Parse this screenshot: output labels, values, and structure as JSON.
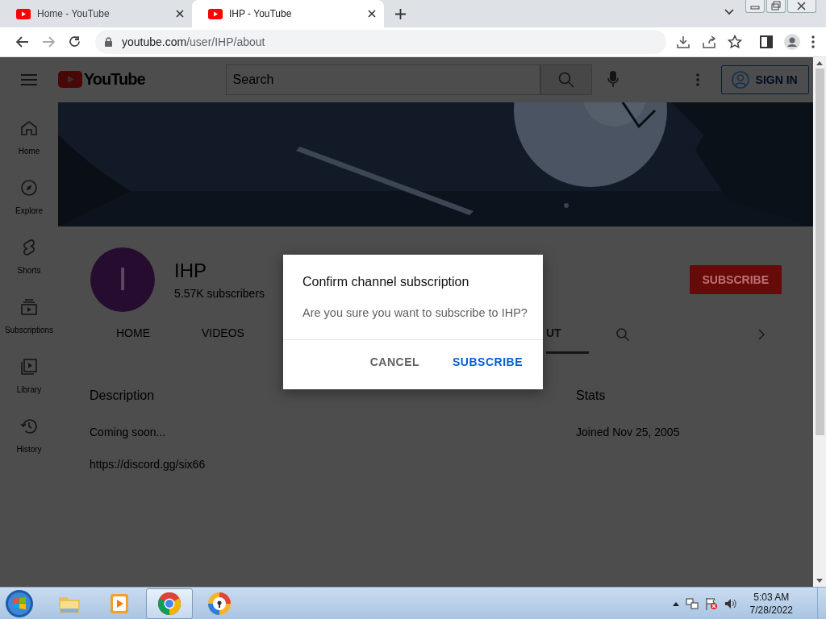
{
  "browser": {
    "tabs": [
      {
        "title": "Home - YouTube",
        "selected": false
      },
      {
        "title": "IHP - YouTube",
        "selected": true
      }
    ],
    "address": {
      "host": "youtube.com",
      "path": "/user/IHP/about"
    }
  },
  "header": {
    "logo": "YouTube",
    "search_placeholder": "Search",
    "sign_in": "SIGN IN"
  },
  "sidebar": {
    "items": [
      {
        "kind": "home",
        "label": "Home"
      },
      {
        "kind": "explore",
        "label": "Explore"
      },
      {
        "kind": "shorts",
        "label": "Shorts"
      },
      {
        "kind": "subscriptions",
        "label": "Subscriptions"
      },
      {
        "kind": "library",
        "label": "Library"
      },
      {
        "kind": "history",
        "label": "History"
      }
    ]
  },
  "channel": {
    "avatar_letter": "I",
    "name": "IHP",
    "subscribers": "5.57K subscribers",
    "subscribe": "SUBSCRIBE",
    "tabs": [
      {
        "label": "HOME",
        "selected": false
      },
      {
        "label": "VIDEOS",
        "selected": false
      },
      {
        "label": "UT",
        "selected": true
      }
    ]
  },
  "about": {
    "description_heading": "Description",
    "description": "Coming soon...",
    "link": "https://discord.gg/six66",
    "stats_heading": "Stats",
    "joined": "Joined Nov 25, 2005"
  },
  "dialog": {
    "title": "Confirm channel subscription",
    "message": "Are you sure you want to subscribe to IHP?",
    "buttons": [
      {
        "kind": "cancel",
        "label": "CANCEL"
      },
      {
        "kind": "confirm",
        "label": "SUBSCRIBE"
      }
    ]
  },
  "taskbar": {
    "apps": [
      {
        "kind": "folder",
        "selected": false
      },
      {
        "kind": "media",
        "selected": false
      },
      {
        "kind": "chrome",
        "selected": true
      },
      {
        "kind": "vpn",
        "selected": false
      }
    ],
    "time": "5:03 AM",
    "date": "7/28/2022"
  }
}
